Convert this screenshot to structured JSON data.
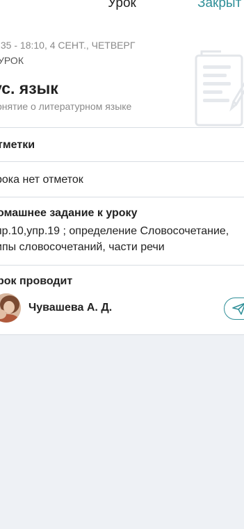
{
  "nav": {
    "title": "Урок",
    "close_label": "Закрыт"
  },
  "lesson": {
    "time": ":35 - 18:10, 4 СЕНТ., ЧЕТВЕРГ",
    "type": "УРОК",
    "subject": "ус. язык",
    "topic": "онятие о литературном языке"
  },
  "marks": {
    "title": "тметки",
    "text": "рока нет отметок"
  },
  "homework": {
    "title": "омашнее задание к уроку",
    "line1": "пр.10,упр.19 ; определение Словосочетание,",
    "line2": "ипы словосочетаний, части речи"
  },
  "teacher": {
    "title": "рок проводит",
    "name": "Чувашева А. Д."
  },
  "icons": {
    "illustration": "document-edit-illustration",
    "send": "paper-plane-icon"
  },
  "colors": {
    "accent": "#2f8f98",
    "background": "#eef1f5",
    "muted_text": "#8a8a8a"
  }
}
